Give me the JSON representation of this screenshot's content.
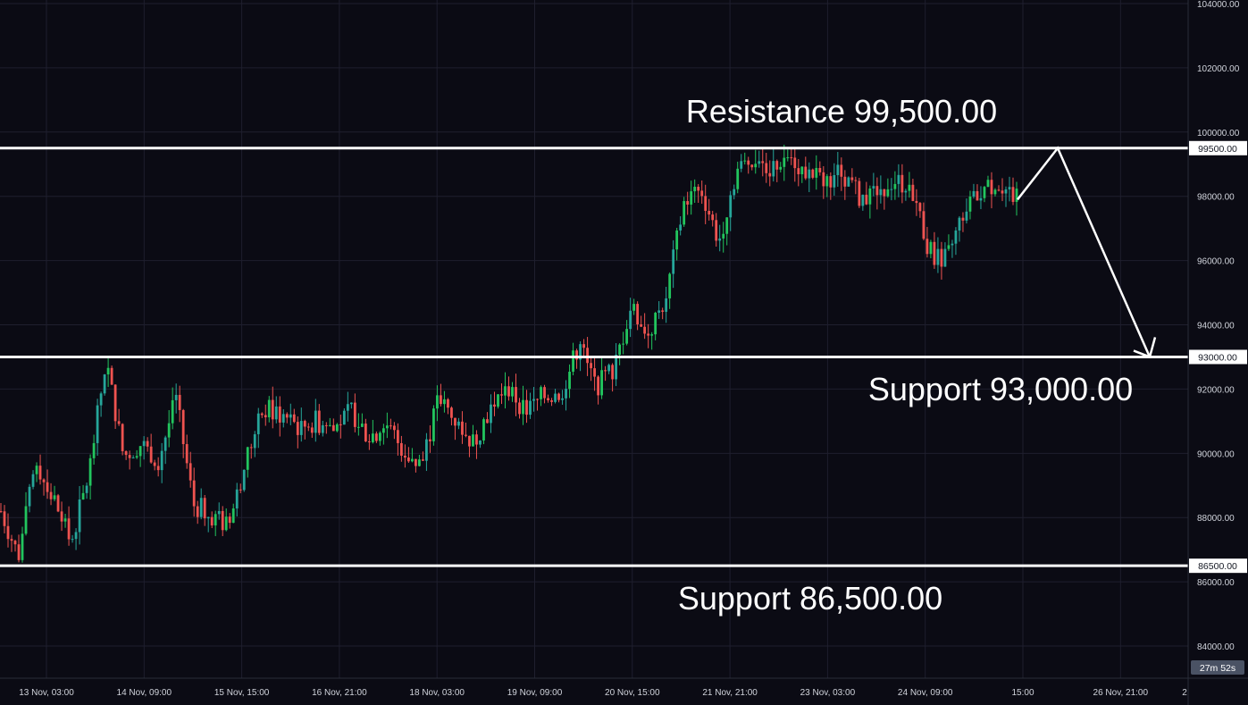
{
  "chart_data": {
    "type": "candlestick",
    "x_labels": [
      "13 Nov, 03:00",
      "14 Nov, 09:00",
      "15 Nov, 15:00",
      "16 Nov, 21:00",
      "18 Nov, 03:00",
      "19 Nov, 09:00",
      "20 Nov, 15:00",
      "21 Nov, 21:00",
      "23 Nov, 03:00",
      "24 Nov, 09:00",
      "15:00",
      "26 Nov, 21:00",
      "2"
    ],
    "y_ticks": [
      "104000.00",
      "102000.00",
      "100000.00",
      "98000.00",
      "96000.00",
      "94000.00",
      "92000.00",
      "90000.00",
      "88000.00",
      "86000.00",
      "84000.00"
    ],
    "ylim": [
      83000,
      104000
    ],
    "grid": true,
    "candle_colors": {
      "up": "#26a69a",
      "down": "#ef5350",
      "up_bright": "#22c55e"
    },
    "close_path": [
      88200,
      86800,
      89700,
      88600,
      87200,
      89300,
      92900,
      89900,
      90300,
      89800,
      91700,
      88400,
      88100,
      87700,
      89800,
      91400,
      91200,
      90800,
      91000,
      90700,
      91300,
      90500,
      90900,
      90100,
      89600,
      91700,
      91000,
      90300,
      91500,
      92000,
      91300,
      91800,
      91900,
      93400,
      92100,
      92600,
      94600,
      93700,
      94900,
      97800,
      98200,
      96600,
      98800,
      99200,
      98900,
      99300,
      98700,
      98500,
      98800,
      98000,
      98200,
      98500,
      98300,
      96300,
      96000,
      97600,
      98200,
      98400,
      97900
    ],
    "levels": [
      {
        "value": 99500,
        "label": "99500.00",
        "annotation": "Resistance 99,500.00"
      },
      {
        "value": 93000,
        "label": "93000.00",
        "annotation": "Support 93,000.00"
      },
      {
        "value": 86500,
        "label": "86500.00",
        "annotation": "Support 86,500.00"
      }
    ],
    "projection": {
      "points": [
        97900,
        99500,
        93000
      ]
    },
    "timer_label": "27m 52s",
    "colors": {
      "background": "#0b0b14",
      "grid": "#1f1f2e",
      "text": "#d1d4dc",
      "level_line": "#ffffff",
      "timer_bg": "#4a5264"
    }
  }
}
